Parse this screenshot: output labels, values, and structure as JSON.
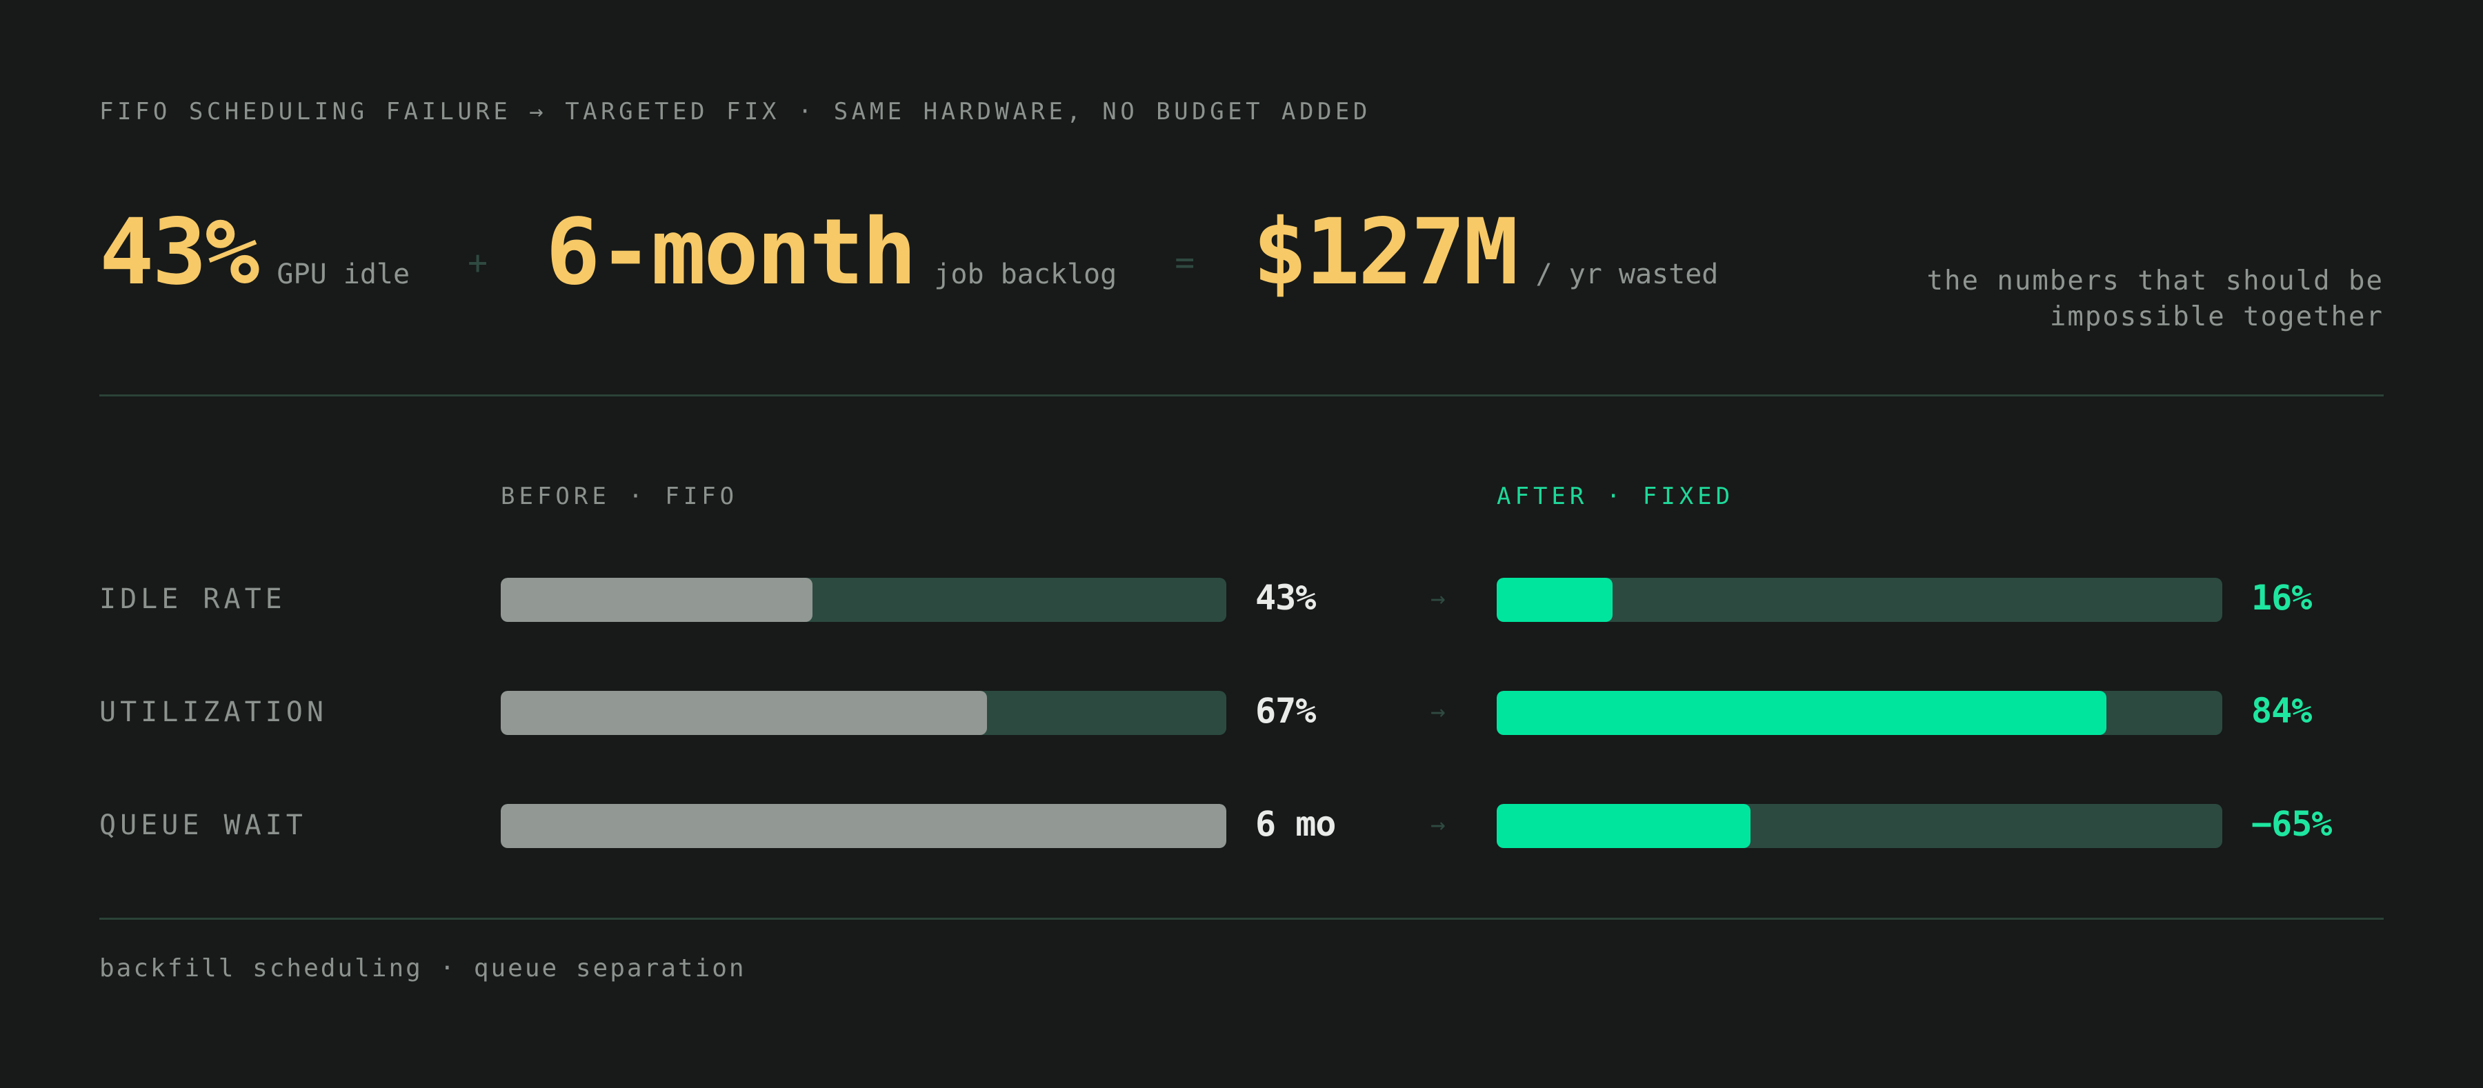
{
  "header": {
    "kicker": "FIFO SCHEDULING FAILURE → TARGETED FIX · SAME HARDWARE, NO BUDGET ADDED"
  },
  "headline": {
    "stat1": {
      "value": "43%",
      "unit": "GPU idle"
    },
    "op1": "+",
    "stat2": {
      "value": "6-month",
      "unit": "job backlog"
    },
    "op2": "=",
    "stat3": {
      "value": "$127M",
      "unit": "/ yr wasted"
    },
    "note": "the numbers that should be impossible together"
  },
  "comparison": {
    "before_heading": "BEFORE · FIFO",
    "after_heading": "AFTER · FIXED",
    "arrow": "→",
    "rows": [
      {
        "label": "IDLE RATE",
        "before_value": "43%",
        "before_fill": 0.43,
        "after_value": "16%",
        "after_fill": 0.16
      },
      {
        "label": "UTILIZATION",
        "before_value": "67%",
        "before_fill": 0.67,
        "after_value": "84%",
        "after_fill": 0.84
      },
      {
        "label": "QUEUE WAIT",
        "before_value": "6 mo",
        "before_fill": 1.0,
        "after_value": "−65%",
        "after_fill": 0.35
      }
    ]
  },
  "footer": {
    "text": "backfill scheduling · queue separation"
  },
  "colors": {
    "background": "#171a19",
    "accent_gold": "#f7c967",
    "accent_green": "#00e59e",
    "before_bar": "#929893",
    "track": "#2c4a40"
  }
}
